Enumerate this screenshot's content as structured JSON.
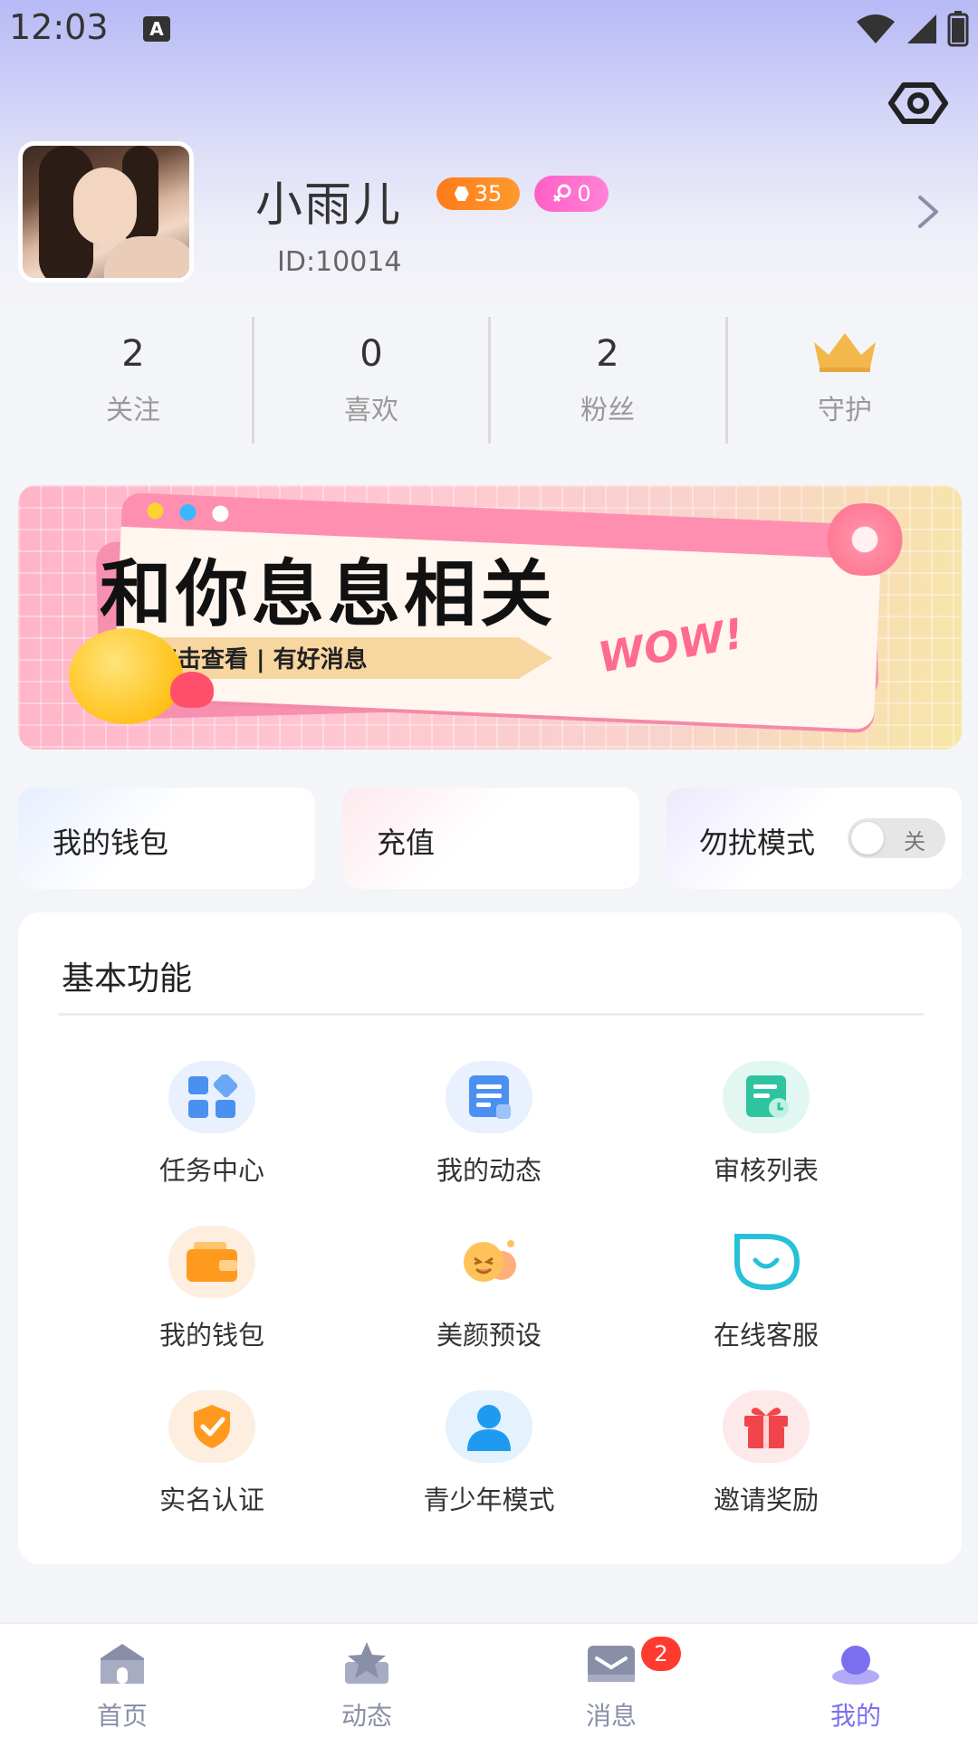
{
  "status_bar": {
    "time": "12:03",
    "indicator": "A"
  },
  "profile": {
    "nickname": "小雨儿",
    "level": "35",
    "gender_count": "0",
    "id_text": "ID:10014"
  },
  "stats": [
    {
      "value": "2",
      "label": "关注"
    },
    {
      "value": "0",
      "label": "喜欢"
    },
    {
      "value": "2",
      "label": "粉丝"
    },
    {
      "value": "",
      "label": "守护"
    }
  ],
  "banner": {
    "headline": "和你息息相关",
    "sub": "点击查看 | 有好消息",
    "wow": "WOW!"
  },
  "quick_actions": {
    "wallet": "我的钱包",
    "recharge": "充值",
    "dnd": "勿扰模式",
    "dnd_state": "关"
  },
  "functions": {
    "title": "基本功能",
    "items": [
      {
        "label": "任务中心",
        "icon": "grid-icon"
      },
      {
        "label": "我的动态",
        "icon": "document-icon"
      },
      {
        "label": "审核列表",
        "icon": "review-icon"
      },
      {
        "label": "我的钱包",
        "icon": "wallet-icon"
      },
      {
        "label": "美颜预设",
        "icon": "beauty-icon"
      },
      {
        "label": "在线客服",
        "icon": "support-icon"
      },
      {
        "label": "实名认证",
        "icon": "shield-check-icon"
      },
      {
        "label": "青少年模式",
        "icon": "person-icon"
      },
      {
        "label": "邀请奖励",
        "icon": "gift-icon"
      }
    ]
  },
  "tabbar": {
    "items": [
      {
        "label": "首页",
        "icon": "home-icon"
      },
      {
        "label": "动态",
        "icon": "star-icon"
      },
      {
        "label": "消息",
        "icon": "mail-icon"
      },
      {
        "label": "我的",
        "icon": "profile-icon"
      }
    ],
    "message_badge": "2"
  },
  "colors": {
    "accent": "#7b6ff0",
    "level_badge": "#ff8a22",
    "gender_badge": "#ff6ccd",
    "badge_red": "#ff3b30"
  }
}
